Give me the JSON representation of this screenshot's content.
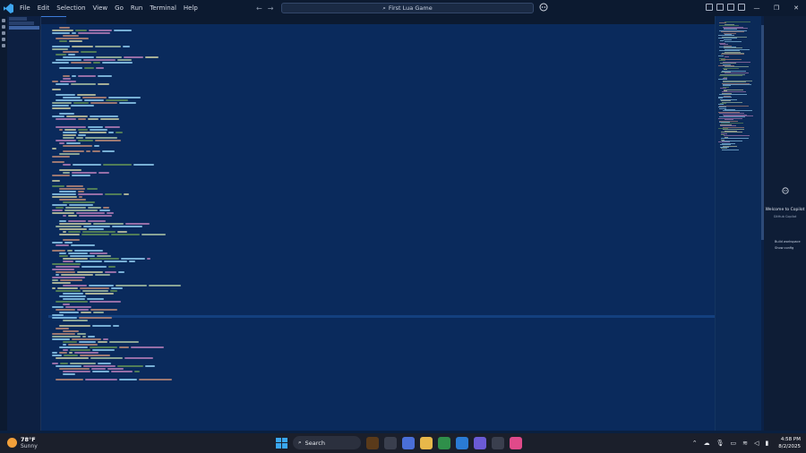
{
  "menu": [
    "File",
    "Edit",
    "Selection",
    "View",
    "Go",
    "Run",
    "Terminal",
    "Help"
  ],
  "search": {
    "text": "First Lua Game"
  },
  "window_controls": [
    "—",
    "❐",
    "✕"
  ],
  "chat": {
    "title": "Welcome to Copilot",
    "subtitle": "GitHub Copilot",
    "items": [
      "Build workspace",
      "Show config"
    ]
  },
  "taskbar": {
    "temperature": "78°F",
    "condition": "Sunny",
    "search_label": "Search",
    "time": "4:58 PM",
    "date": "8/2/2025"
  },
  "colors": {
    "editor_bg": "#0a2a5c",
    "accent": "#3d7bd9",
    "keyword": "#c586c0",
    "string": "#ce9178",
    "function": "#dcdcaa",
    "variable": "#9cdcfe",
    "comment": "#6a9955",
    "number": "#b5cea8"
  }
}
